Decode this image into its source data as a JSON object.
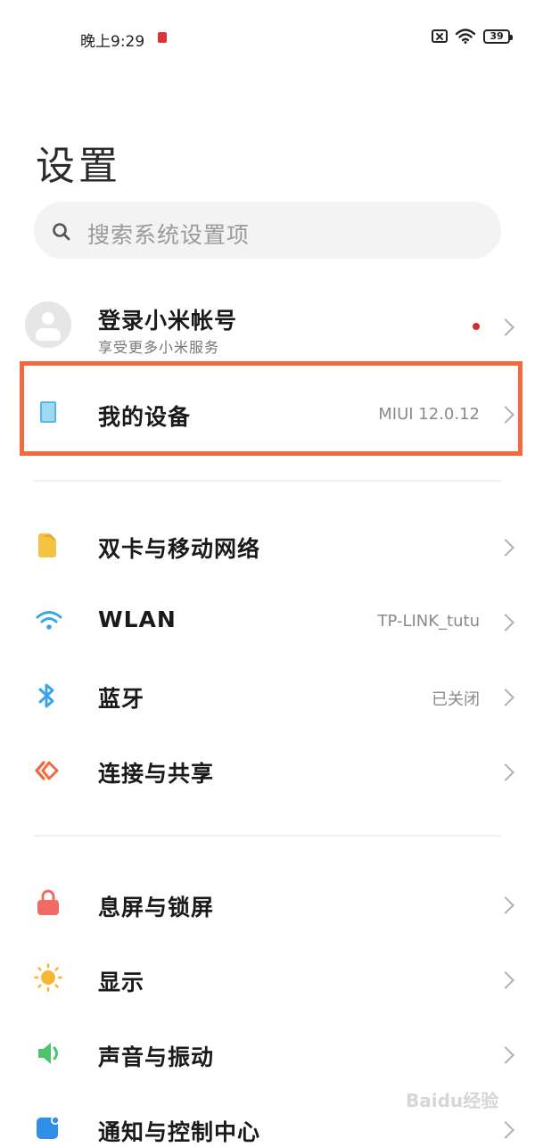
{
  "status_bar": {
    "time": "晚上9:29",
    "battery": "39"
  },
  "page": {
    "title": "设置"
  },
  "search": {
    "placeholder": "搜索系统设置项"
  },
  "account": {
    "title": "登录小米帐号",
    "subtitle": "享受更多小米服务"
  },
  "device": {
    "label": "我的设备",
    "value": "MIUI 12.0.12"
  },
  "connectivity": [
    {
      "label": "双卡与移动网络",
      "value": "",
      "icon": "sim-card-icon"
    },
    {
      "label": "WLAN",
      "value": "TP-LINK_tutu",
      "icon": "wifi-icon"
    },
    {
      "label": "蓝牙",
      "value": "已关闭",
      "icon": "bluetooth-icon"
    },
    {
      "label": "连接与共享",
      "value": "",
      "icon": "connection-share-icon"
    }
  ],
  "personal": [
    {
      "label": "息屏与锁屏",
      "icon": "lock-icon"
    },
    {
      "label": "显示",
      "icon": "sun-icon"
    },
    {
      "label": "声音与振动",
      "icon": "speaker-icon"
    },
    {
      "label": "通知与控制中心",
      "icon": "notification-icon"
    }
  ],
  "watermark": "Baidu经验",
  "colors": {
    "highlight": "#ef6a3c",
    "notification_dot": "#d52d2d",
    "sim_yellow": "#f5c242",
    "wifi_blue": "#3aa6e8",
    "lock_red": "#f06b63",
    "sun_orange": "#f7b733",
    "speaker_green": "#4cc46a",
    "notification_blue": "#2f8fe6"
  }
}
